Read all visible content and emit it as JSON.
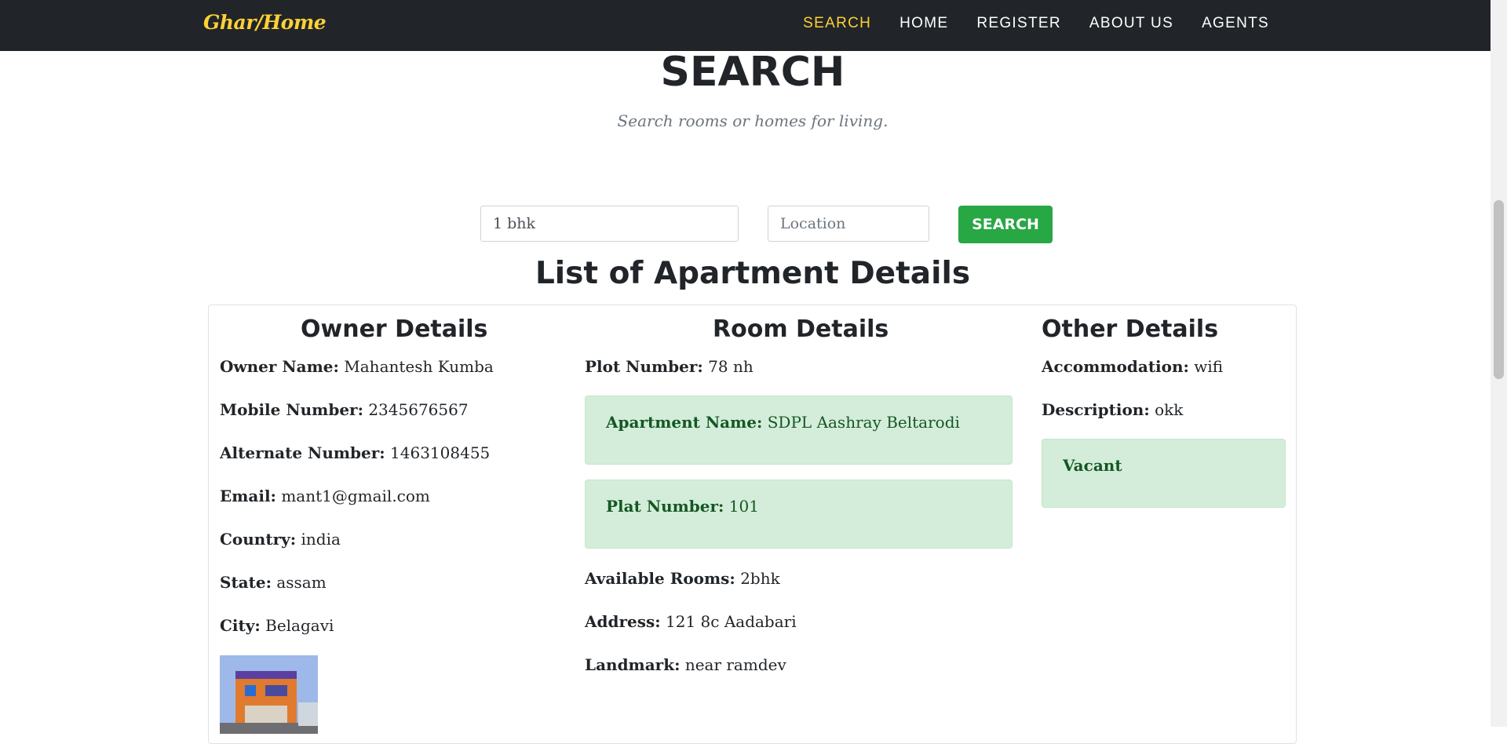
{
  "nav": {
    "brand": "Ghar/Home",
    "links": [
      "SEARCH",
      "HOME",
      "REGISTER",
      "ABOUT US",
      "AGENTS"
    ]
  },
  "header": {
    "title": "SEARCH",
    "subtitle": "Search rooms or homes for living."
  },
  "search": {
    "keyword_value": "1 bhk",
    "location_placeholder": "Location",
    "button_label": "SEARCH"
  },
  "list_title": "List of Apartment Details",
  "owner": {
    "heading": "Owner Details",
    "name_label": "Owner Name:",
    "name": "Mahantesh Kumba",
    "mobile_label": "Mobile Number:",
    "mobile": "2345676567",
    "alt_label": "Alternate Number:",
    "alt": "1463108455",
    "email_label": "Email:",
    "email": "mant1@gmail.com",
    "country_label": "Country:",
    "country": "india",
    "state_label": "State:",
    "state": "assam",
    "city_label": "City:",
    "city": "Belagavi"
  },
  "room": {
    "heading": "Room Details",
    "plot_label": "Plot Number:",
    "plot": "78 nh",
    "apt_label": "Apartment Name:",
    "apt": "SDPL Aashray Beltarodi",
    "plat_label": "Plat Number:",
    "plat": "101",
    "rooms_label": "Available Rooms:",
    "rooms": "2bhk",
    "address_label": "Address:",
    "address": "121 8c Aadabari",
    "landmark_label": "Landmark:",
    "landmark": "near ramdev"
  },
  "other": {
    "heading": "Other Details",
    "accom_label": "Accommodation:",
    "accom": "wifi",
    "desc_label": "Description:",
    "desc": "okk",
    "status": "Vacant"
  },
  "colors": {
    "navbar": "#212529",
    "accent": "#fed136",
    "success": "#28a745",
    "alert_bg": "#d4edda"
  }
}
